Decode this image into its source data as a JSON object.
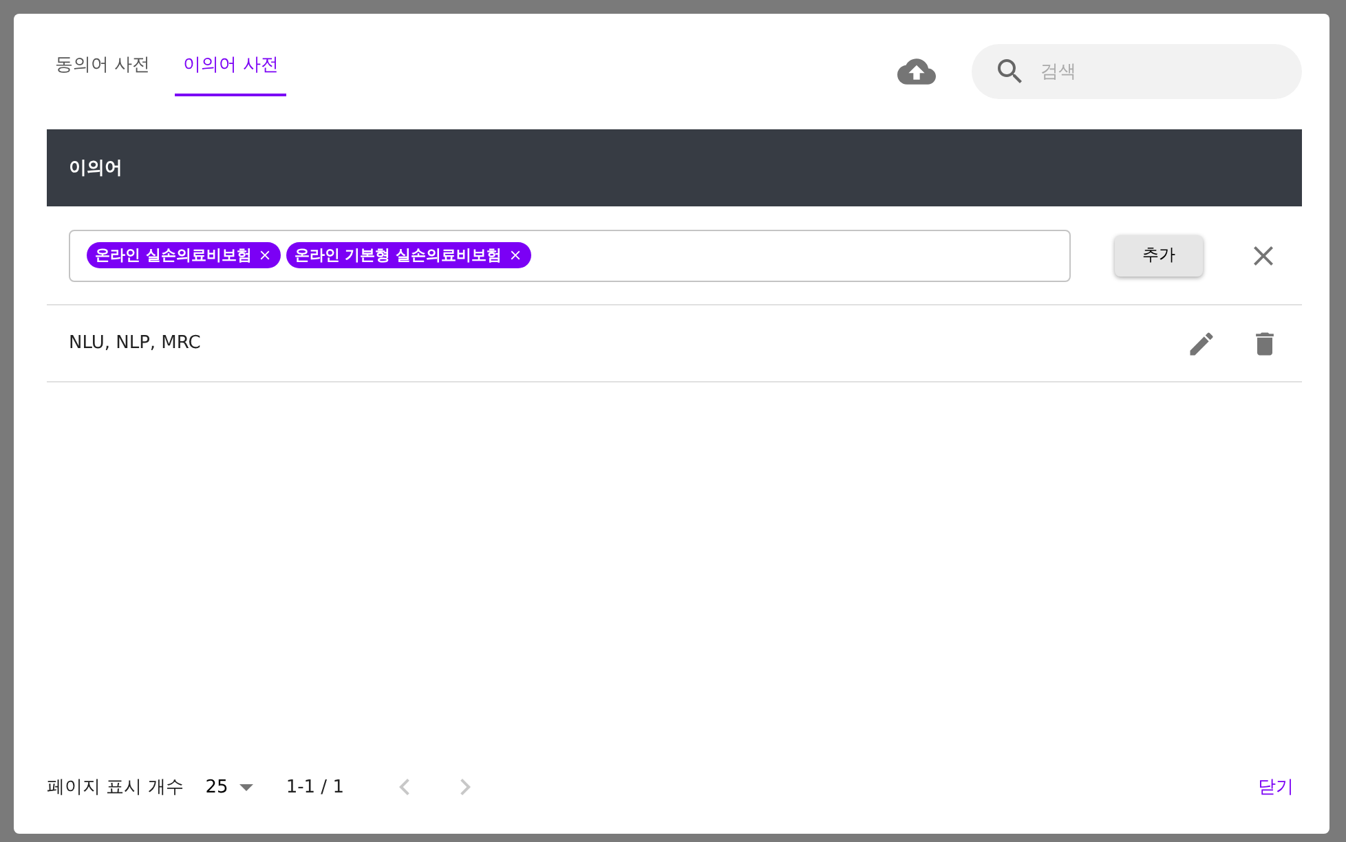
{
  "tabs": [
    {
      "label": "동의어 사전",
      "selected": false
    },
    {
      "label": "이의어 사전",
      "selected": true
    }
  ],
  "search": {
    "placeholder": "검색"
  },
  "table": {
    "columns": [
      "이의어"
    ],
    "editor": {
      "chips": [
        "온라인 실손의료비보험",
        "온라인 기본형 실손의료비보험"
      ],
      "add_label": "추가"
    },
    "rows": [
      {
        "text": "NLU, NLP, MRC"
      }
    ]
  },
  "footer": {
    "page_size_label": "페이지 표시 개수",
    "page_size": "25",
    "range": "1-1 / 1",
    "prev_disabled": true,
    "next_disabled": true,
    "close_label": "닫기"
  }
}
